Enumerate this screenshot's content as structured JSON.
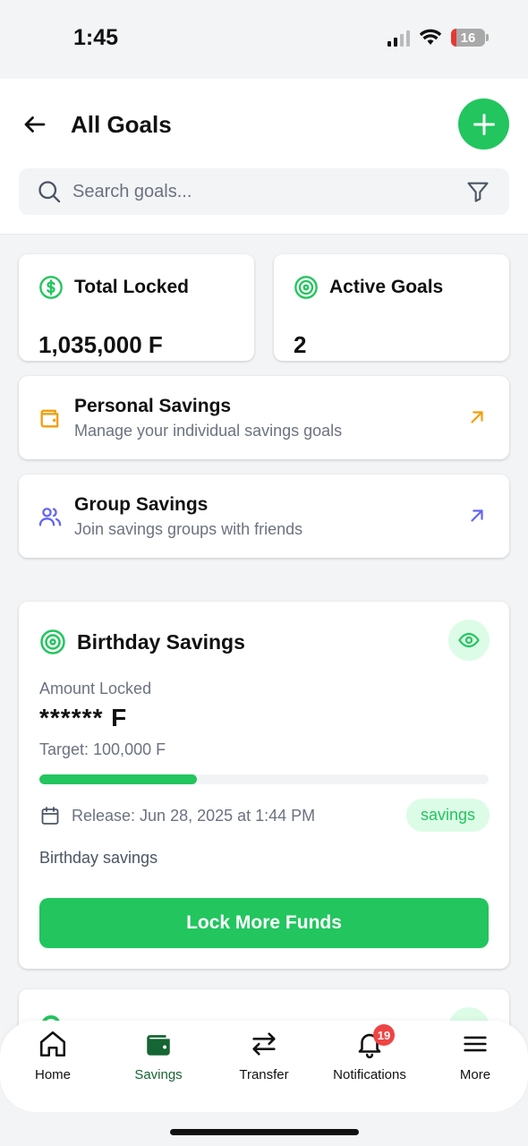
{
  "status_bar": {
    "time": "1:45",
    "battery": "16"
  },
  "header": {
    "title": "All Goals"
  },
  "search": {
    "placeholder": "Search goals..."
  },
  "stats": {
    "total_locked_label": "Total Locked",
    "total_locked_value": "1,035,000 F",
    "active_goals_label": "Active Goals",
    "active_goals_value": "2"
  },
  "nav_cards": [
    {
      "title": "Personal Savings",
      "subtitle": "Manage your individual savings goals",
      "color": "#f59e0b"
    },
    {
      "title": "Group Savings",
      "subtitle": "Join savings groups with friends",
      "color": "#6366f1"
    }
  ],
  "goal": {
    "title": "Birthday Savings",
    "amount_label": "Amount Locked",
    "amount_value": "****** F",
    "target": "Target: 100,000 F",
    "progress_fraction": 0.35,
    "release": "Release: Jun 28, 2025 at 1:44 PM",
    "tag": "savings",
    "description": "Birthday savings",
    "button_label": "Lock More Funds"
  },
  "tabs": [
    {
      "label": "Home",
      "icon": "home-icon"
    },
    {
      "label": "Savings",
      "icon": "wallet-icon",
      "active": true
    },
    {
      "label": "Transfer",
      "icon": "transfer-icon"
    },
    {
      "label": "Notifications",
      "icon": "bell-icon",
      "badge": "19"
    },
    {
      "label": "More",
      "icon": "menu-icon"
    }
  ],
  "colors": {
    "accent": "#22c55e",
    "accent_light": "#dcfce7",
    "active_tab": "#166534",
    "badge": "#ef4444"
  }
}
